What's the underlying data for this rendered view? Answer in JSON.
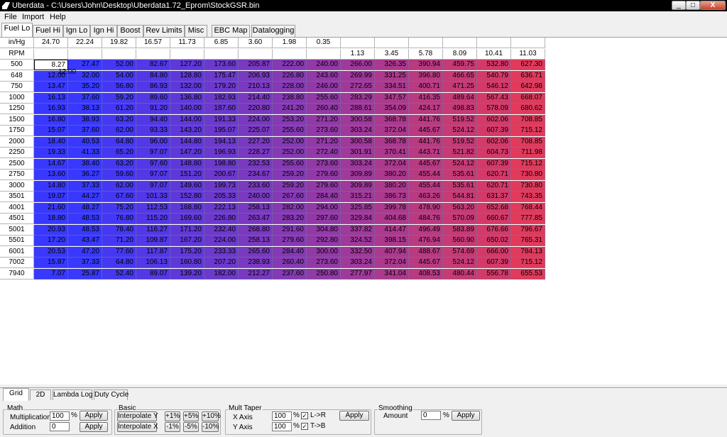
{
  "window": {
    "title": "Uberdata - C:\\Users\\John\\Desktop\\Uberdata1.72_Eprom\\StockGSR.bin",
    "minimize_label": "_",
    "maximize_label": "□",
    "close_label": "X"
  },
  "menu": [
    "File",
    "Import",
    "Help"
  ],
  "tabs": [
    "Fuel Lo",
    "Fuel Hi",
    "Ign Lo",
    "Ign Hi",
    "Boost",
    "Rev Limits",
    "Misc",
    "EBC Map",
    "Datalogging"
  ],
  "active_tab": "Fuel Lo",
  "grid": {
    "row1_label": "in/Hg",
    "row2_label": "RPM",
    "inhg": [
      "24.70",
      "22.24",
      "19.82",
      "16.57",
      "11.73",
      "6.85",
      "3.60",
      "1.98",
      "0.35",
      "",
      "",
      "",
      "",
      "",
      ""
    ],
    "boost": [
      "",
      "",
      "",
      "",
      "",
      "",
      "",
      "",
      "",
      "1.13",
      "3.45",
      "5.78",
      "8.09",
      "10.41",
      "11.03"
    ],
    "rpm": [
      "500",
      "648",
      "750",
      "1000",
      "1250",
      "1500",
      "1750",
      "2000",
      "2250",
      "2500",
      "2750",
      "3000",
      "3501",
      "4001",
      "4501",
      "5001",
      "5501",
      "6001",
      "7002",
      "7940"
    ],
    "values": [
      [
        "8.27",
        "27.47",
        "52.00",
        "82.67",
        "127.20",
        "173.60",
        "205.87",
        "222.00",
        "240.00",
        "266.00",
        "326.35",
        "390.94",
        "459.75",
        "532.80",
        "627.30"
      ],
      [
        "12.00",
        "32.00",
        "54.00",
        "84.80",
        "128.80",
        "175.47",
        "206.93",
        "226.80",
        "243.60",
        "269.99",
        "331.25",
        "396.80",
        "466.65",
        "540.79",
        "636.71"
      ],
      [
        "13.47",
        "35.20",
        "56.80",
        "86.93",
        "132.00",
        "179.20",
        "210.13",
        "228.00",
        "246.00",
        "272.65",
        "334.51",
        "400.71",
        "471.25",
        "546.12",
        "642.98"
      ],
      [
        "16.13",
        "37.60",
        "59.20",
        "89.60",
        "136.80",
        "182.93",
        "214.40",
        "238.80",
        "255.60",
        "283.29",
        "347.57",
        "416.35",
        "489.64",
        "567.43",
        "668.07"
      ],
      [
        "16.93",
        "38.13",
        "61.20",
        "91.20",
        "140.00",
        "187.60",
        "220.80",
        "241.20",
        "260.40",
        "288.61",
        "354.09",
        "424.17",
        "498.83",
        "578.09",
        "680.62"
      ],
      [
        "16.80",
        "38.93",
        "63.20",
        "94.40",
        "144.00",
        "191.33",
        "224.00",
        "253.20",
        "271.20",
        "300.58",
        "368.78",
        "441.76",
        "519.52",
        "602.06",
        "708.85"
      ],
      [
        "15.07",
        "37.60",
        "62.00",
        "93.33",
        "143.20",
        "195.07",
        "225.07",
        "255.60",
        "273.60",
        "303.24",
        "372.04",
        "445.67",
        "524.12",
        "607.39",
        "715.12"
      ],
      [
        "18.40",
        "40.53",
        "64.80",
        "96.00",
        "144.80",
        "194.13",
        "227.20",
        "252.00",
        "271.20",
        "300.58",
        "368.78",
        "441.76",
        "519.52",
        "602.06",
        "708.85"
      ],
      [
        "19.33",
        "41.33",
        "65.20",
        "97.07",
        "147.20",
        "196.93",
        "228.27",
        "252.00",
        "272.40",
        "301.91",
        "370.41",
        "443.71",
        "521.82",
        "604.73",
        "711.98"
      ],
      [
        "14.67",
        "38.40",
        "63.20",
        "97.60",
        "148.80",
        "198.80",
        "232.53",
        "255.60",
        "273.60",
        "303.24",
        "372.04",
        "445.67",
        "524.12",
        "607.39",
        "715.12"
      ],
      [
        "13.60",
        "36.27",
        "59.60",
        "97.07",
        "151.20",
        "200.67",
        "234.67",
        "259.20",
        "279.60",
        "309.89",
        "380.20",
        "455.44",
        "535.61",
        "620.71",
        "730.80"
      ],
      [
        "14.80",
        "37.33",
        "62.00",
        "97.07",
        "149.60",
        "199.73",
        "233.60",
        "259.20",
        "279.60",
        "309.89",
        "380.20",
        "455.44",
        "535.61",
        "620.71",
        "730.80"
      ],
      [
        "19.07",
        "44.27",
        "67.60",
        "101.33",
        "152.80",
        "205.33",
        "240.00",
        "267.60",
        "284.40",
        "315.21",
        "386.73",
        "463.26",
        "544.81",
        "631.37",
        "743.35"
      ],
      [
        "21.60",
        "48.27",
        "75.20",
        "112.53",
        "168.80",
        "222.13",
        "258.13",
        "282.00",
        "294.00",
        "325.85",
        "399.78",
        "478.90",
        "563.20",
        "652.68",
        "768.44"
      ],
      [
        "18.80",
        "48.53",
        "76.80",
        "115.20",
        "169.60",
        "226.80",
        "263.47",
        "283.20",
        "297.60",
        "329.84",
        "404.68",
        "484.76",
        "570.09",
        "660.67",
        "777.85"
      ],
      [
        "20.93",
        "48.53",
        "78.40",
        "116.27",
        "171.20",
        "232.40",
        "268.80",
        "291.60",
        "304.80",
        "337.82",
        "414.47",
        "496.49",
        "583.89",
        "676.66",
        "796.67"
      ],
      [
        "17.20",
        "43.47",
        "71.20",
        "109.87",
        "167.20",
        "224.00",
        "258.13",
        "279.60",
        "292.80",
        "324.52",
        "398.15",
        "476.94",
        "560.90",
        "650.02",
        "765.31"
      ],
      [
        "20.53",
        "47.20",
        "77.60",
        "117.87",
        "175.20",
        "233.33",
        "265.60",
        "284.40",
        "300.00",
        "332.50",
        "407.94",
        "488.67",
        "574.69",
        "666.00",
        "784.13"
      ],
      [
        "15.87",
        "37.33",
        "64.80",
        "106.13",
        "160.80",
        "207.20",
        "238.93",
        "260.40",
        "273.60",
        "303.24",
        "372.04",
        "445.67",
        "524.12",
        "607.39",
        "715.12"
      ],
      [
        "7.07",
        "25.87",
        "52.40",
        "89.07",
        "139.20",
        "182.00",
        "212.27",
        "237.60",
        "250.80",
        "277.97",
        "341.04",
        "408.53",
        "480.44",
        "556.78",
        "655.53"
      ]
    ],
    "edit_overlay_value": "12.00",
    "color_low": "#3838ff",
    "color_high": "#e03a5c"
  },
  "bottom_tabs": [
    "Grid",
    "2D",
    "Lambda Log",
    "Duty Cycle"
  ],
  "controls": {
    "math": {
      "title": "Math",
      "multiplication_label": "Multiplication",
      "multiplication_value": "100",
      "percent": "%",
      "apply1": "Apply",
      "addition_label": "Addition",
      "addition_value": "0",
      "apply2": "Apply"
    },
    "basic": {
      "title": "Basic",
      "interp_y": "Interpolate Y",
      "interp_x": "Interpolate X",
      "p1": "+1%",
      "p5": "+5%",
      "p10": "+10%",
      "m1": "-1%",
      "m5": "-5%",
      "m10": "-10%"
    },
    "taper": {
      "title": "Mult Taper",
      "x_axis": "X Axis",
      "y_axis": "Y Axis",
      "x_value": "100",
      "y_value": "100",
      "percent": "%",
      "lr": "L->R",
      "tb": "T->B",
      "apply": "Apply"
    },
    "smoothing": {
      "title": "Smoothing",
      "amount_label": "Amount",
      "amount_value": "0",
      "percent": "%",
      "apply": "Apply"
    }
  }
}
